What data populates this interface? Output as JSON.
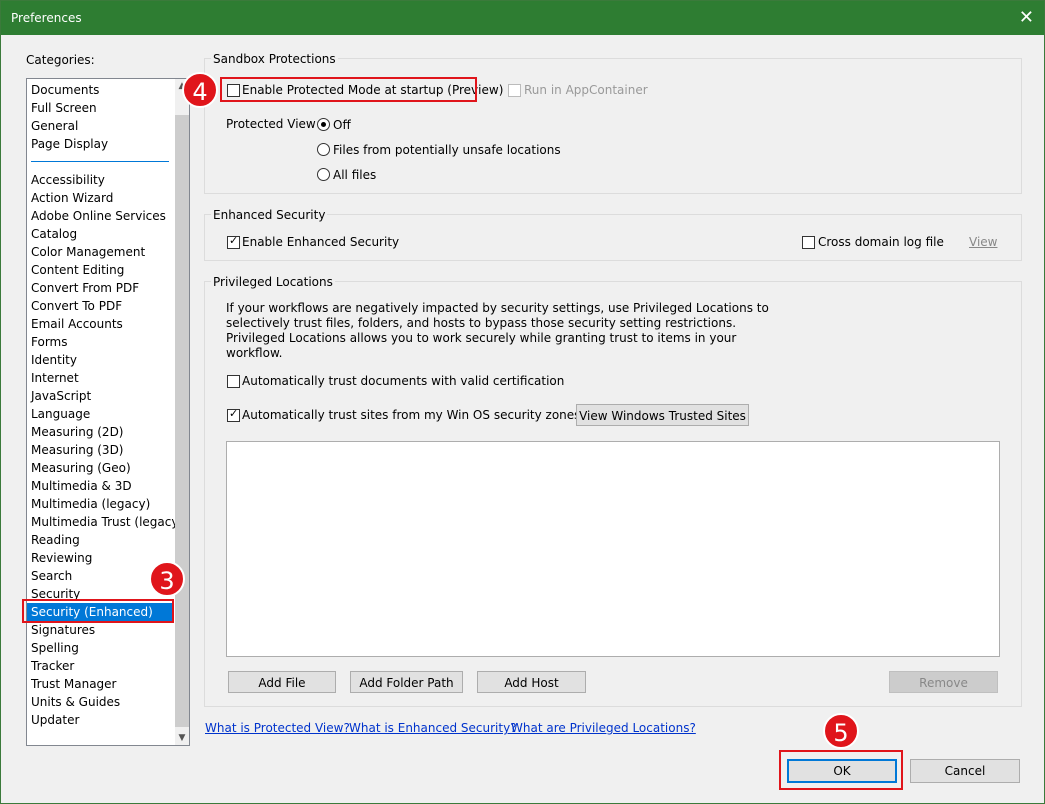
{
  "window": {
    "title": "Preferences",
    "close_glyph": "✕"
  },
  "categories": {
    "label": "Categories:",
    "group1": [
      "Documents",
      "Full Screen",
      "General",
      "Page Display"
    ],
    "group2": [
      "Accessibility",
      "Action Wizard",
      "Adobe Online Services",
      "Catalog",
      "Color Management",
      "Content Editing",
      "Convert From PDF",
      "Convert To PDF",
      "Email Accounts",
      "Forms",
      "Identity",
      "Internet",
      "JavaScript",
      "Language",
      "Measuring (2D)",
      "Measuring (3D)",
      "Measuring (Geo)",
      "Multimedia & 3D",
      "Multimedia (legacy)",
      "Multimedia Trust (legacy)",
      "Reading",
      "Reviewing",
      "Search",
      "Security",
      "Security (Enhanced)",
      "Signatures",
      "Spelling",
      "Tracker",
      "Trust Manager",
      "Units & Guides",
      "Updater"
    ],
    "selected": "Security (Enhanced)"
  },
  "sandbox": {
    "title": "Sandbox Protections",
    "enable_protected_mode": {
      "label": "Enable Protected Mode at startup (Preview)",
      "checked": false
    },
    "run_in_appcontainer": {
      "label": "Run in AppContainer",
      "checked": false,
      "disabled": true
    },
    "protected_view": {
      "label": "Protected View",
      "options": [
        "Off",
        "Files from potentially unsafe locations",
        "All files"
      ],
      "selected": "Off"
    }
  },
  "enhanced": {
    "title": "Enhanced Security",
    "enable_enhanced": {
      "label": "Enable Enhanced Security",
      "checked": true
    },
    "cross_domain_log": {
      "label": "Cross domain log file",
      "checked": false
    },
    "view_link": "View"
  },
  "privileged": {
    "title": "Privileged Locations",
    "description": [
      "If your workflows are negatively impacted by security settings, use Privileged Locations to",
      "selectively trust files, folders, and hosts to bypass those security setting restrictions.",
      "Privileged Locations allows you to work securely while granting trust to items in your",
      "workflow."
    ],
    "trust_certified": {
      "label": "Automatically trust documents with valid certification",
      "checked": false
    },
    "trust_win_zones": {
      "label": "Automatically trust sites from my Win OS security zones",
      "checked": true
    },
    "view_windows_trusted_sites": "View Windows Trusted Sites",
    "add_file": "Add File",
    "add_folder_path": "Add Folder Path",
    "add_host": "Add Host",
    "remove": "Remove"
  },
  "links": {
    "protected_view": "What is Protected View?",
    "enhanced_security": "What is Enhanced Security?",
    "privileged_locations": "What are Privileged Locations?"
  },
  "footer": {
    "ok": "OK",
    "cancel": "Cancel"
  },
  "annotations": {
    "step3": "3",
    "step4": "4",
    "step5": "5"
  },
  "colors": {
    "titlebar": "#2e7d32",
    "selection": "#0078d7",
    "highlight": "#e0151b"
  }
}
